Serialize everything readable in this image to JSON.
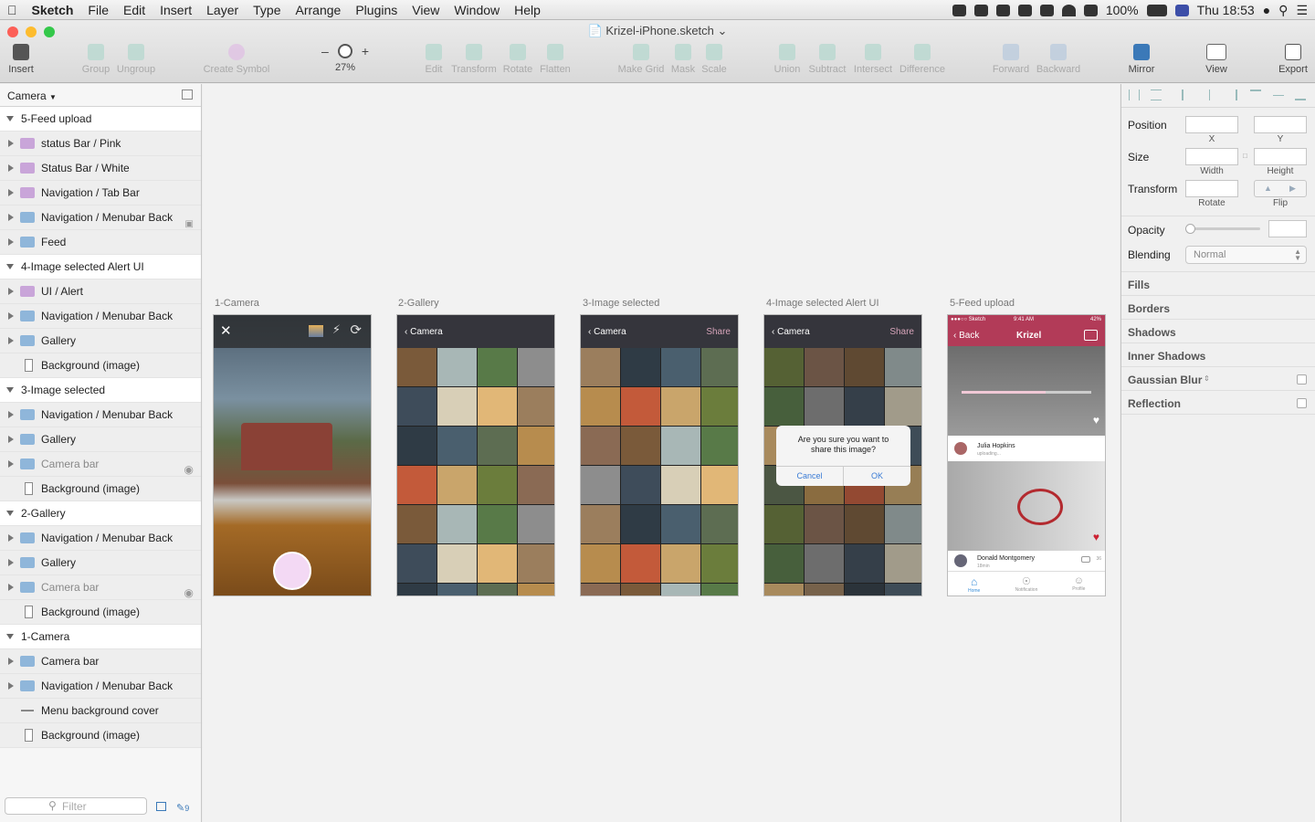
{
  "menubar": {
    "app": "Sketch",
    "items": [
      "File",
      "Edit",
      "Insert",
      "Layer",
      "Type",
      "Arrange",
      "Plugins",
      "View",
      "Window",
      "Help"
    ],
    "battery": "100%",
    "clock": "Thu 18:53"
  },
  "window": {
    "title": "Krizel-iPhone.sketch"
  },
  "toolbar": {
    "insert": "Insert",
    "group": "Group",
    "ungroup": "Ungroup",
    "create_symbol": "Create Symbol",
    "zoom_out": "–",
    "zoom_in": "+",
    "zoom": "27%",
    "edit": "Edit",
    "transform": "Transform",
    "rotate": "Rotate",
    "flatten": "Flatten",
    "make_grid": "Make Grid",
    "mask": "Mask",
    "scale": "Scale",
    "union": "Union",
    "subtract": "Subtract",
    "intersect": "Intersect",
    "difference": "Difference",
    "forward": "Forward",
    "backward": "Backward",
    "mirror": "Mirror",
    "view": "View",
    "export": "Export"
  },
  "layers": {
    "page": "Camera",
    "filter_placeholder": "Filter",
    "slice_count": "9",
    "rows": [
      {
        "label": "5-Feed upload",
        "kind": "group"
      },
      {
        "label": "status Bar / Pink",
        "kind": "folder-pink"
      },
      {
        "label": "Status Bar / White",
        "kind": "folder-pink"
      },
      {
        "label": "Navigation / Tab Bar",
        "kind": "folder-pink"
      },
      {
        "label": "Navigation / Menubar Back",
        "kind": "folder",
        "locked": true
      },
      {
        "label": "Feed",
        "kind": "folder"
      },
      {
        "label": "4-Image selected Alert UI",
        "kind": "group"
      },
      {
        "label": "UI / Alert",
        "kind": "folder-pink"
      },
      {
        "label": "Navigation / Menubar Back",
        "kind": "folder"
      },
      {
        "label": "Gallery",
        "kind": "folder"
      },
      {
        "label": "Background (image)",
        "kind": "rect"
      },
      {
        "label": "3-Image selected",
        "kind": "group"
      },
      {
        "label": "Navigation / Menubar Back",
        "kind": "folder"
      },
      {
        "label": "Gallery",
        "kind": "folder"
      },
      {
        "label": "Camera bar",
        "kind": "folder",
        "hidden": true
      },
      {
        "label": "Background (image)",
        "kind": "rect"
      },
      {
        "label": "2-Gallery",
        "kind": "group"
      },
      {
        "label": "Navigation / Menubar Back",
        "kind": "folder"
      },
      {
        "label": "Gallery",
        "kind": "folder"
      },
      {
        "label": "Camera bar",
        "kind": "folder",
        "hidden": true
      },
      {
        "label": "Background (image)",
        "kind": "rect"
      },
      {
        "label": "1-Camera",
        "kind": "group"
      },
      {
        "label": "Camera bar",
        "kind": "folder"
      },
      {
        "label": "Navigation / Menubar Back",
        "kind": "folder"
      },
      {
        "label": "Menu background cover",
        "kind": "line"
      },
      {
        "label": "Background (image)",
        "kind": "rect"
      }
    ]
  },
  "artboards": [
    {
      "label": "1-Camera"
    },
    {
      "label": "2-Gallery",
      "nav": "Camera"
    },
    {
      "label": "3-Image selected",
      "nav": "Camera",
      "share": "Share"
    },
    {
      "label": "4-Image selected Alert UI",
      "nav": "Camera",
      "share": "Share"
    },
    {
      "label": "5-Feed upload"
    }
  ],
  "alert": {
    "message": "Are you sure you want to share this image?",
    "cancel": "Cancel",
    "ok": "OK"
  },
  "feed": {
    "status_left": "●●●○○ Sketch",
    "status_time": "9:41 AM",
    "status_right": "42%",
    "back": "Back",
    "title": "Krizel",
    "user1": "Julia Hopkins",
    "user1_sub": "uploading...",
    "user2": "Donald Montgomery",
    "user2_sub": "18min",
    "comments": "36",
    "tabs": [
      "Home",
      "Notification",
      "Profile"
    ]
  },
  "inspector": {
    "position": "Position",
    "x": "X",
    "y": "Y",
    "size": "Size",
    "width": "Width",
    "height": "Height",
    "transform": "Transform",
    "rotate": "Rotate",
    "flip": "Flip",
    "opacity": "Opacity",
    "blending": "Blending",
    "blending_value": "Normal",
    "sections": [
      "Fills",
      "Borders",
      "Shadows",
      "Inner Shadows",
      "Gaussian Blur",
      "Reflection"
    ]
  },
  "colors": {
    "feed_accent": "#b23b58",
    "close": "#fc5f57",
    "minimize": "#fdbc2e",
    "zoom": "#34c84a",
    "capture": "#f3d9f4"
  }
}
